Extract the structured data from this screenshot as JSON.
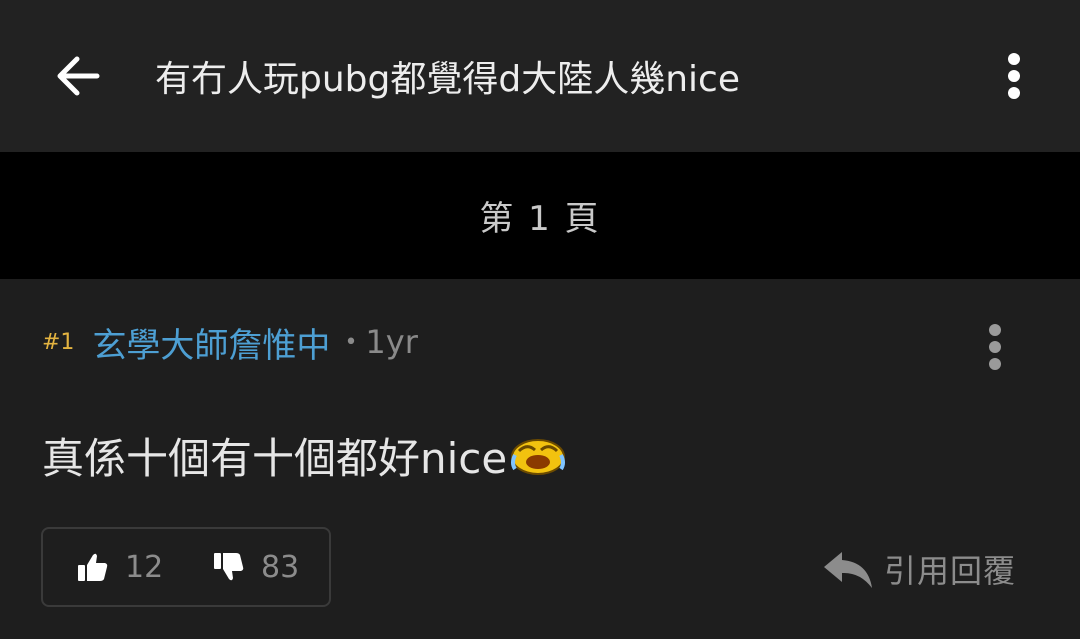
{
  "header": {
    "title": "有冇人玩pubg都覺得d大陸人幾nice",
    "back_icon": "arrow-left-icon",
    "menu_icon": "more-vertical-icon"
  },
  "page_banner": {
    "label": "第 1 頁"
  },
  "post": {
    "floor": "#1",
    "author": "玄學大師詹惟中",
    "separator": "•",
    "time": "1yr",
    "content": "真係十個有十個都好nice",
    "emoji_icon": "laughing-crying-emoji-icon",
    "menu_icon": "more-vertical-icon",
    "upvotes": "12",
    "downvotes": "83",
    "reply_label": "引用回覆"
  },
  "colors": {
    "header_bg": "#222222",
    "banner_bg": "#000000",
    "post_bg": "#1e1e1e",
    "author": "#4d9fd3",
    "floor": "#e3b340",
    "muted": "#8c8c8c"
  }
}
